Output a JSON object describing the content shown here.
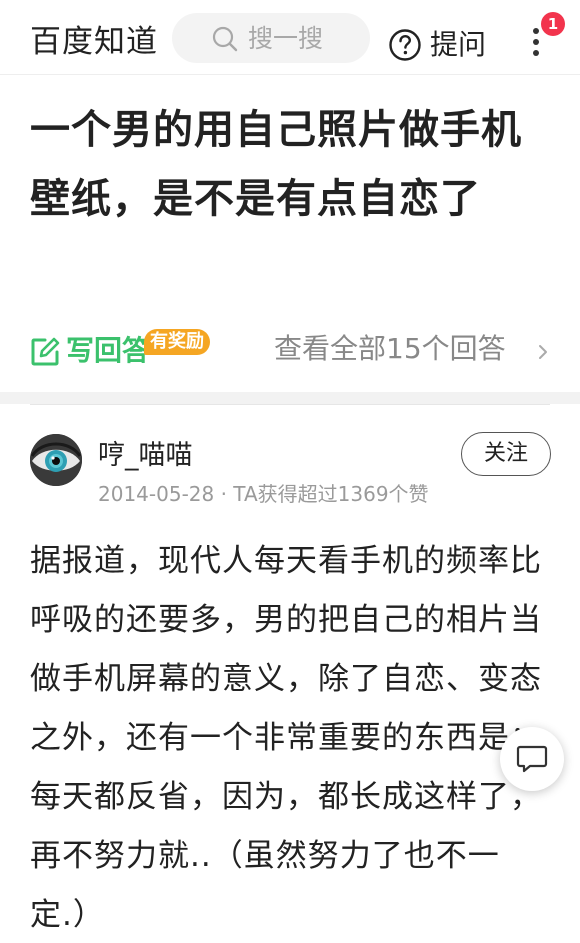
{
  "header": {
    "logo": "百度知道",
    "search_placeholder": "搜一搜",
    "ask_label": "提问",
    "notification_count": "1"
  },
  "question": {
    "title": "一个男的用自己照片做手机壁纸，是不是有点自恋了",
    "write_answer_label": "写回答",
    "reward_tag": "有奖励",
    "view_all_label": "查看全部15个回答"
  },
  "answer": {
    "username": "哼_喵喵",
    "meta": "2014-05-28 · TA获得超过1369个赞",
    "follow_label": "关注",
    "body": "据报道，现代人每天看手机的频率比呼吸的还要多，男的把自己的相片当做手机屏幕的意义，除了自恋、变态之外，还有一个非常重要的东西是：每天都反省，因为，都长成这样了，再不努力就..（虽然努力了也不一定.）"
  },
  "colors": {
    "accent_green": "#3bc16c",
    "reward_orange": "#f5a623",
    "badge_red": "#f2344d"
  },
  "icons": {
    "search": "search-icon",
    "ask": "question-circle-icon",
    "more": "more-vertical-icon",
    "write": "edit-icon",
    "chevron": "chevron-right-icon",
    "fab": "comment-bubble-icon"
  }
}
